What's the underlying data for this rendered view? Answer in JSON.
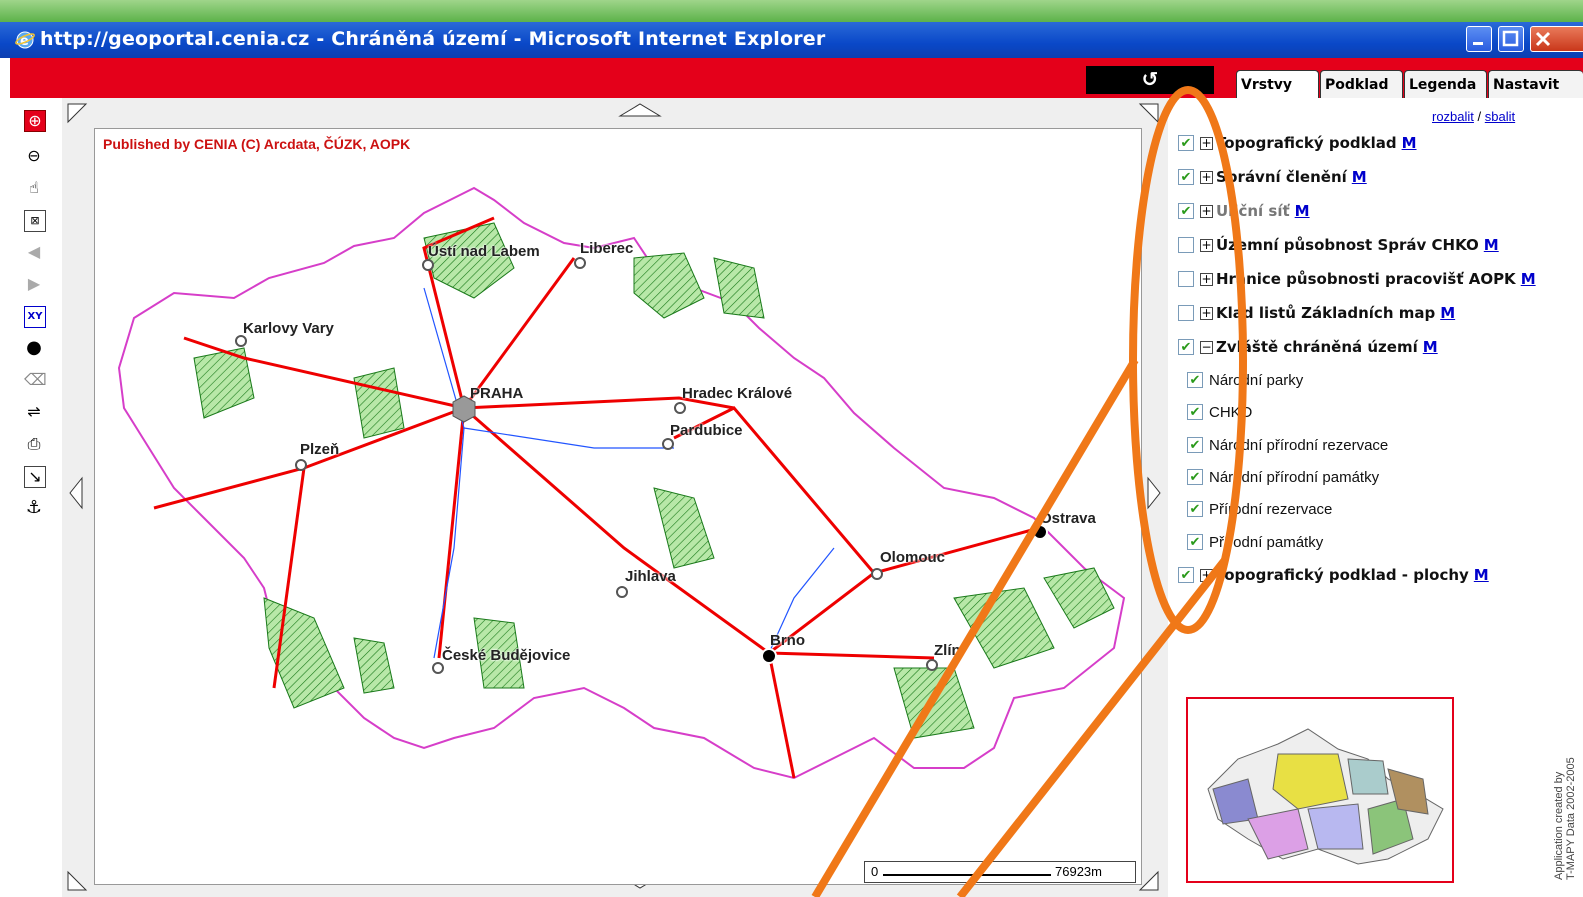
{
  "window": {
    "title": "http://geoportal.cenia.cz - Chráněná území - Microsoft Internet Explorer"
  },
  "toolbar": {
    "refresh_glyph": "↺"
  },
  "tabs": [
    {
      "label": "Vrstvy",
      "active": true
    },
    {
      "label": "Podklad",
      "active": false
    },
    {
      "label": "Legenda",
      "active": false
    },
    {
      "label": "Nastavit",
      "active": false
    }
  ],
  "panel_links": {
    "expand": "rozbalit",
    "separator": "/",
    "collapse": "sbalit"
  },
  "layers": [
    {
      "label": "Topografický podklad",
      "checked": true,
      "expander": "+",
      "m": "M"
    },
    {
      "label": "Správní členění",
      "checked": true,
      "expander": "+",
      "m": "M"
    },
    {
      "label": "Uliční síť",
      "checked": true,
      "expander": "+",
      "m": "M"
    },
    {
      "label": "Územní působnost Správ CHKO",
      "checked": false,
      "expander": "+",
      "m": "M"
    },
    {
      "label": "Hranice působnosti pracovišť AOPK",
      "checked": false,
      "expander": "+",
      "m": "M"
    },
    {
      "label": "Klad listů Základních map",
      "checked": false,
      "expander": "+",
      "m": "M"
    },
    {
      "label": "Zvláště chráněná území",
      "checked": true,
      "expander": "−",
      "m": "M"
    }
  ],
  "sublayers": [
    {
      "label": "Národní parky",
      "checked": true
    },
    {
      "label": "CHKO",
      "checked": true
    },
    {
      "label": "Národní přírodní rezervace",
      "checked": true
    },
    {
      "label": "Národní přírodní památky",
      "checked": true
    },
    {
      "label": "Přírodní rezervace",
      "checked": true
    },
    {
      "label": "Přírodní památky",
      "checked": true
    }
  ],
  "last_layer": {
    "label": "Topografický podklad - plochy",
    "checked": true,
    "expander": "+",
    "m": "M"
  },
  "map": {
    "credit": "Published by CENIA    (C) Arcdata, ČÚZK, AOPK",
    "scale": {
      "zero": "0",
      "value": "76923m"
    },
    "cities": [
      "Ústí nad Labem",
      "Liberec",
      "Karlovy Vary",
      "PRAHA",
      "Hradec Králové",
      "Pardubice",
      "Plzeň",
      "Ostrava",
      "Olomouc",
      "Jihlava",
      "Brno",
      "Zlín",
      "České Budějovice"
    ]
  },
  "app_credit": {
    "line1": "Application created by",
    "line2": "T-MAPY Data 2002-2005"
  },
  "colors": {
    "red_bar": "#e4001a",
    "titlebar": "#0a48c8",
    "highlight": "#f07818"
  },
  "tools": [
    "zoom-in-icon",
    "zoom-out-icon",
    "pan-hand-icon",
    "full-extent-icon",
    "back-arrow-icon",
    "forward-arrow-icon",
    "xy-coordinates-icon",
    "info-icon",
    "eraser-icon",
    "measure-icon",
    "print-icon",
    "export-icon",
    "anchor-icon"
  ]
}
